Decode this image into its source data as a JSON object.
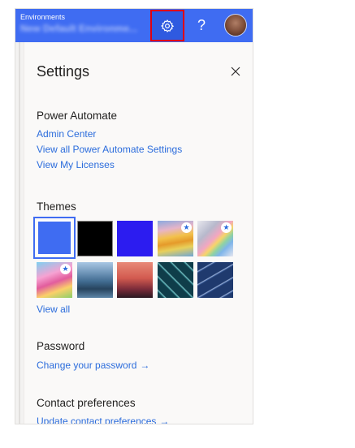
{
  "topbar": {
    "env_label": "Environments",
    "env_name": "New Default Environme...",
    "help_glyph": "?"
  },
  "settings": {
    "title": "Settings",
    "power_automate": {
      "heading": "Power Automate",
      "links": [
        "Admin Center",
        "View all Power Automate Settings",
        "View My Licenses"
      ]
    },
    "themes": {
      "heading": "Themes",
      "view_all": "View all",
      "swatches": [
        {
          "name": "blue",
          "color": "#3f6cf2",
          "selected": true,
          "starred": false
        },
        {
          "name": "black",
          "color": "#000000",
          "selected": false,
          "starred": false
        },
        {
          "name": "violet-blue",
          "color": "#2c1cf0",
          "selected": false,
          "starred": false
        },
        {
          "name": "sunset-waves",
          "color": "#e5b35a",
          "selected": false,
          "starred": true
        },
        {
          "name": "rainbow-ribbons",
          "color": "#c7c9d8",
          "selected": false,
          "starred": true
        },
        {
          "name": "pink-illustration",
          "color": "#e57db9",
          "selected": false,
          "starred": true
        },
        {
          "name": "mountain-lake",
          "color": "#4c7fa6",
          "selected": false,
          "starred": false
        },
        {
          "name": "palm-sunset",
          "color": "#d25a4f",
          "selected": false,
          "starred": false
        },
        {
          "name": "circuit-board",
          "color": "#1d5a68",
          "selected": false,
          "starred": false
        },
        {
          "name": "blueprint",
          "color": "#2d4a82",
          "selected": false,
          "starred": false
        }
      ]
    },
    "password": {
      "heading": "Password",
      "link": "Change your password",
      "arrow": "→"
    },
    "contact": {
      "heading": "Contact preferences",
      "link": "Update contact preferences",
      "arrow": "→"
    }
  }
}
